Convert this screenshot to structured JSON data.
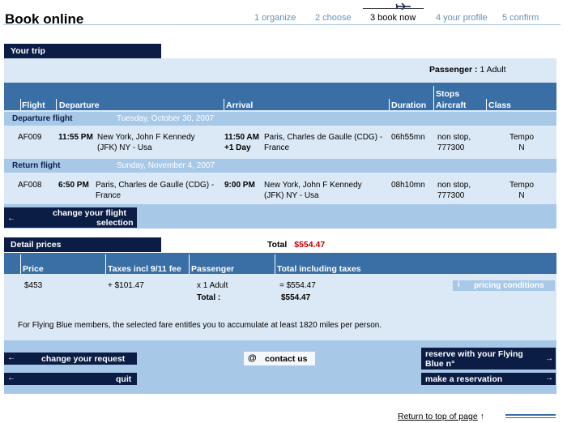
{
  "page_title": "Book online",
  "steps": [
    {
      "label": "1 organize"
    },
    {
      "label": "2 choose"
    },
    {
      "label": "3 book now"
    },
    {
      "label": "4 your profile"
    },
    {
      "label": "5 confirm"
    }
  ],
  "your_trip": {
    "label": "Your trip",
    "passenger_label": "Passenger :",
    "passenger_value": "1 Adult"
  },
  "flight_columns": {
    "flight": "Flight",
    "departure": "Departure",
    "arrival": "Arrival",
    "duration": "Duration",
    "stops": "Stops",
    "aircraft": "Aircraft",
    "class": "Class"
  },
  "departure_segment": {
    "label": "Departure flight",
    "date": "Tuesday, October 30, 2007",
    "flight": "AF009",
    "dep_time": "11:55 PM",
    "dep_place_1": "New York, John F Kennedy",
    "dep_place_2": "(JFK) NY - Usa",
    "arr_time": "11:50 AM",
    "arr_day": "+1 Day",
    "arr_place_1": "Paris, Charles de Gaulle (CDG) -",
    "arr_place_2": "France",
    "duration": "06h55mn",
    "stops": "non stop,",
    "aircraft": "777300",
    "class_1": "Tempo",
    "class_2": "N"
  },
  "return_segment": {
    "label": "Return flight",
    "date": "Sunday, November 4, 2007",
    "flight": "AF008",
    "dep_time": "6:50 PM",
    "dep_place_1": "Paris, Charles de Gaulle (CDG) -",
    "dep_place_2": "France",
    "arr_time": "9:00 PM",
    "arr_place_1": "New York, John F Kennedy",
    "arr_place_2": "(JFK) NY - Usa",
    "duration": "08h10mn",
    "stops": "non stop,",
    "aircraft": "777300",
    "class_1": "Tempo",
    "class_2": "N"
  },
  "change_flight": {
    "line1": "change your flight",
    "line2": "selection"
  },
  "detail_prices": {
    "label": "Detail prices",
    "total_label": "Total",
    "total_value": "$554.47",
    "columns": {
      "price": "Price",
      "taxes": "Taxes incl 9/11 fee",
      "passenger": "Passenger",
      "total_incl": "Total including taxes"
    },
    "row": {
      "price": "$453",
      "taxes": "+ $101.47",
      "passenger": "x 1 Adult",
      "total_incl": "= $554.47"
    },
    "sum_label": "Total :",
    "sum_value": "$554.47",
    "pricing_conditions": "pricing conditions",
    "miles_note": "For Flying Blue members, the selected fare entitles you to accumulate at least 1820 miles per person."
  },
  "actions": {
    "change_request": "change your request",
    "quit": "quit",
    "contact_us": "contact us",
    "reserve_flying_blue_1": "reserve with your Flying",
    "reserve_flying_blue_2": "Blue n°",
    "make_reservation": "make a reservation"
  },
  "footer": {
    "return_top": "Return to top of page"
  },
  "colors": {
    "navy": "#0b1d45",
    "column_header_blue": "#3a6fa6",
    "segment_blue": "#a8c8e8",
    "panel_blue": "#dbe8f5",
    "total_red": "#c00000"
  }
}
